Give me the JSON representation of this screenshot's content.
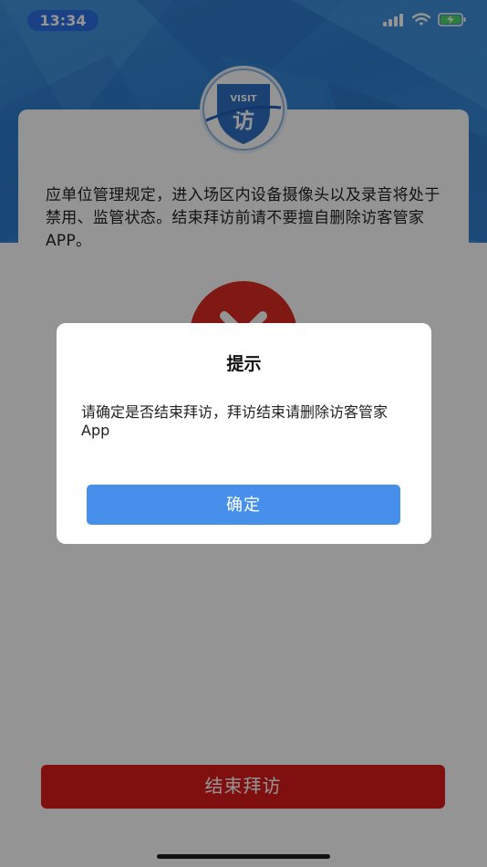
{
  "status_bar": {
    "time": "13:34",
    "icons": [
      "cellular-signal-icon",
      "wifi-icon",
      "battery-charging-icon"
    ]
  },
  "logo": {
    "top_text": "VISIT",
    "glyph": "访"
  },
  "notice": {
    "text": "应单位管理规定，进入场区内设备摄像头以及录音将处于禁用、监管状态。结束拜访前请不要擅自删除访客管家 APP。"
  },
  "status_circle": {
    "icon": "close-icon",
    "color": "#dd2b24"
  },
  "end_visit_button": {
    "label": "结束拜访",
    "color": "#dd1c1c"
  },
  "dialog": {
    "title": "提示",
    "message": "请确定是否结束拜访，拜访结束请删除访客管家 App",
    "confirm_label": "确定",
    "confirm_color": "#4690ec"
  },
  "colors": {
    "header_blue": "#2f7fd0",
    "time_pill": "#2d6fe5"
  }
}
